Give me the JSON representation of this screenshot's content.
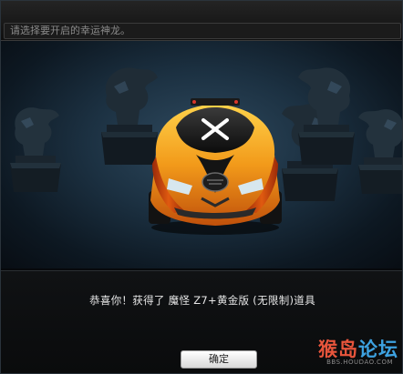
{
  "header": {
    "instruction_text": "请选择要开启的幸运神龙。"
  },
  "stage": {
    "statues": [
      "dragon-statue",
      "dragon-statue",
      "dragon-statue",
      "dragon-statue",
      "dragon-statue",
      "dragon-statue"
    ],
    "reward_item": "car-icon"
  },
  "message": {
    "text": "恭喜你！获得了 魔怪 Z7+黄金版 (无限制)道具"
  },
  "buttons": {
    "ok_label": "确定"
  },
  "watermark": {
    "part1": "猴岛",
    "part2": "论坛",
    "url": "BBS.HOUDAO.COM"
  },
  "colors": {
    "accent_orange": "#f29a1a",
    "stage_blue": "#2f4a5f",
    "watermark_red": "#e8553c",
    "watermark_blue": "#3da1e0"
  }
}
